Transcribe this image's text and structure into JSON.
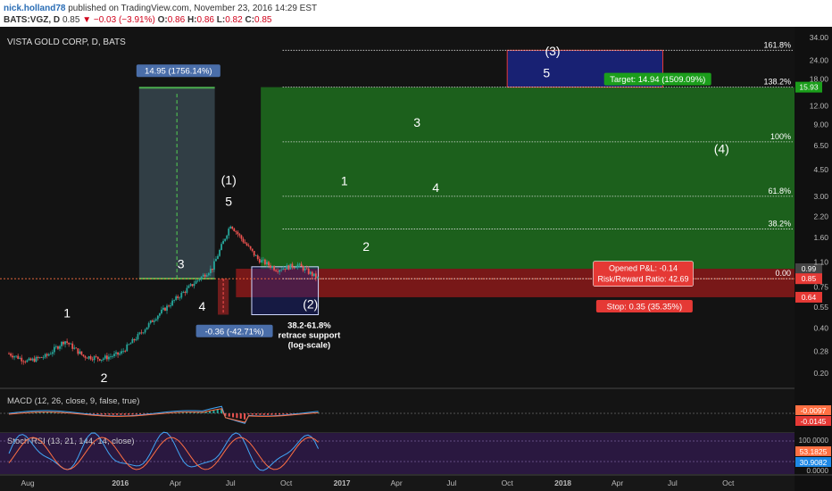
{
  "header": {
    "user": "nick.holland78",
    "published": "published on TradingView.com, November 23, 2016 14:29 EST",
    "symbol": "BATS:VGZ, D",
    "last": "0.85",
    "arrow": "▼",
    "change": "−0.03 (−3.91%)",
    "o_label": "O:",
    "o": "0.86",
    "h_label": "H:",
    "h": "0.86",
    "l_label": "L:",
    "l": "0.82",
    "c_label": "C:",
    "c": "0.85"
  },
  "chart_title": "VISTA GOLD CORP, D, BATS",
  "colors": {
    "up": "#26a69a",
    "down": "#ef5350",
    "target_zone": "#1b7a1b",
    "stop_zone": "#b71c1c",
    "box_dark": "#37474f",
    "projection": "#1a237e",
    "panel_bg": "#1a1a1a",
    "stoch_bg": "#3b1f5e"
  },
  "chart_data": {
    "type": "candlestick",
    "title": "VISTA GOLD CORP, D, BATS",
    "y_scale": "log",
    "ylim": [
      0.17,
      35
    ],
    "y_ticks": [
      34.0,
      24.0,
      18.0,
      12.0,
      9.0,
      6.5,
      4.5,
      3.0,
      2.2,
      1.6,
      1.1,
      0.75,
      0.55,
      0.4,
      0.28,
      0.2
    ],
    "x_ticks": [
      "Aug",
      "2016",
      "Apr",
      "Jul",
      "Oct",
      "2017",
      "Apr",
      "Jul",
      "Oct",
      "2018",
      "Apr",
      "Jul",
      "Oct"
    ],
    "price_path": [
      [
        "2015-07-01",
        0.27
      ],
      [
        "2015-08-01",
        0.24
      ],
      [
        "2015-09-01",
        0.26
      ],
      [
        "2015-10-01",
        0.33
      ],
      [
        "2015-11-01",
        0.26
      ],
      [
        "2015-12-01",
        0.25
      ],
      [
        "2016-01-01",
        0.27
      ],
      [
        "2016-02-01",
        0.36
      ],
      [
        "2016-03-01",
        0.48
      ],
      [
        "2016-04-01",
        0.62
      ],
      [
        "2016-05-01",
        0.79
      ],
      [
        "2016-06-01",
        1.0
      ],
      [
        "2016-07-01",
        1.95
      ],
      [
        "2016-07-20",
        1.55
      ],
      [
        "2016-08-15",
        1.15
      ],
      [
        "2016-09-15",
        0.98
      ],
      [
        "2016-10-20",
        1.05
      ],
      [
        "2016-11-23",
        0.85
      ]
    ],
    "price_labels": {
      "current": "0.85",
      "entry": "0.99",
      "stop": "0.64",
      "target": "15.93"
    },
    "fib_levels": [
      {
        "label": "161.8%",
        "value": 28.0
      },
      {
        "label": "138.2%",
        "value": 15.93
      },
      {
        "label": "100%",
        "value": 6.9
      },
      {
        "label": "61.8%",
        "value": 3.0
      },
      {
        "label": "38.2%",
        "value": 1.82
      },
      {
        "label": "0.00",
        "value": 0.85
      }
    ],
    "wave_labels": [
      {
        "text": "1",
        "date": "2015-10-05",
        "value": 0.47
      },
      {
        "text": "2",
        "date": "2015-12-05",
        "value": 0.175
      },
      {
        "text": "3",
        "date": "2016-04-10",
        "value": 1.0
      },
      {
        "text": "4",
        "date": "2016-05-15",
        "value": 0.52
      },
      {
        "text": "(1)",
        "date": "2016-06-28",
        "value": 3.6
      },
      {
        "text": "5",
        "date": "2016-06-28",
        "value": 2.6
      },
      {
        "text": "(2)",
        "date": "2016-11-10",
        "value": 0.54
      },
      {
        "text": "1",
        "date": "2017-01-05",
        "value": 3.55
      },
      {
        "text": "2",
        "date": "2017-02-10",
        "value": 1.3
      },
      {
        "text": "3",
        "date": "2017-05-05",
        "value": 8.7
      },
      {
        "text": "4",
        "date": "2017-06-05",
        "value": 3.2
      },
      {
        "text": "(3)",
        "date": "2017-12-15",
        "value": 26
      },
      {
        "text": "5",
        "date": "2017-12-05",
        "value": 18.5
      },
      {
        "text": "(4)",
        "date": "2018-09-20",
        "value": 5.8
      }
    ],
    "annotations": {
      "gain_box": "14.95 (1756.14%)",
      "drop_box": "-0.36 (-42.71%)",
      "retrace": [
        "38.2-61.8%",
        "retrace support",
        "(log-scale)"
      ],
      "target": "Target: 14.94 (1509.09%)",
      "stop": "Stop: 0.35 (35.35%)",
      "opened_pl": "Opened P&L: -0.14",
      "risk_reward": "Risk/Reward Ratio: 42.69"
    },
    "macd": {
      "title": "MACD (12, 26, close, 9, false, true)",
      "labels": [
        "-0.0097",
        "-0.0145"
      ]
    },
    "stoch_rsi": {
      "title": "Stoch RSI (13, 21, 144, 14, close)",
      "labels": [
        "53.1825",
        "30.9082"
      ],
      "ticks": [
        "100.0000",
        "0.0000"
      ]
    }
  }
}
